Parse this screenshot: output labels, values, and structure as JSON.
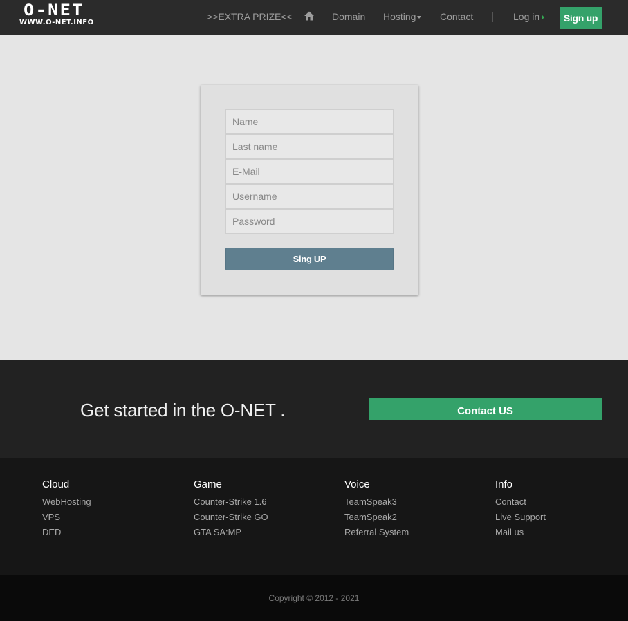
{
  "brand": {
    "logo_text": "O-NET",
    "logo_subtext": "WWW.O-NET.INFO"
  },
  "nav": {
    "extra_prize": ">>EXTRA PRIZE<<",
    "home_icon": "home-icon",
    "domain": "Domain",
    "hosting": "Hosting",
    "contact": "Contact",
    "login": "Log in",
    "signup": "Sign up"
  },
  "form": {
    "name_placeholder": "Name",
    "lastname_placeholder": "Last name",
    "email_placeholder": "E-Mail",
    "username_placeholder": "Username",
    "password_placeholder": "Password",
    "submit_label": "Sing UP"
  },
  "cta": {
    "text": "Get started in the O-NET .",
    "button": "Contact US"
  },
  "footer": {
    "columns": [
      {
        "title": "Cloud",
        "items": [
          "WebHosting",
          "VPS",
          "DED"
        ]
      },
      {
        "title": "Game",
        "items": [
          "Counter-Strike 1.6",
          "Counter-Strike GO",
          "GTA SA:MP"
        ]
      },
      {
        "title": "Voice",
        "items": [
          "TeamSpeak3",
          "TeamSpeak2",
          "Referral System"
        ]
      },
      {
        "title": "Info",
        "items": [
          "Contact",
          "Live Support",
          "Mail us"
        ]
      }
    ],
    "copyright": "Copyright © 2012 - 2021"
  },
  "colors": {
    "accent_green": "#34a26a",
    "submit_button": "#5f7f8f",
    "navbar_bg": "#2b2b2b",
    "cta_bg": "#222222",
    "footer_bg": "#161616",
    "copyright_bg": "#0a0a0a"
  }
}
